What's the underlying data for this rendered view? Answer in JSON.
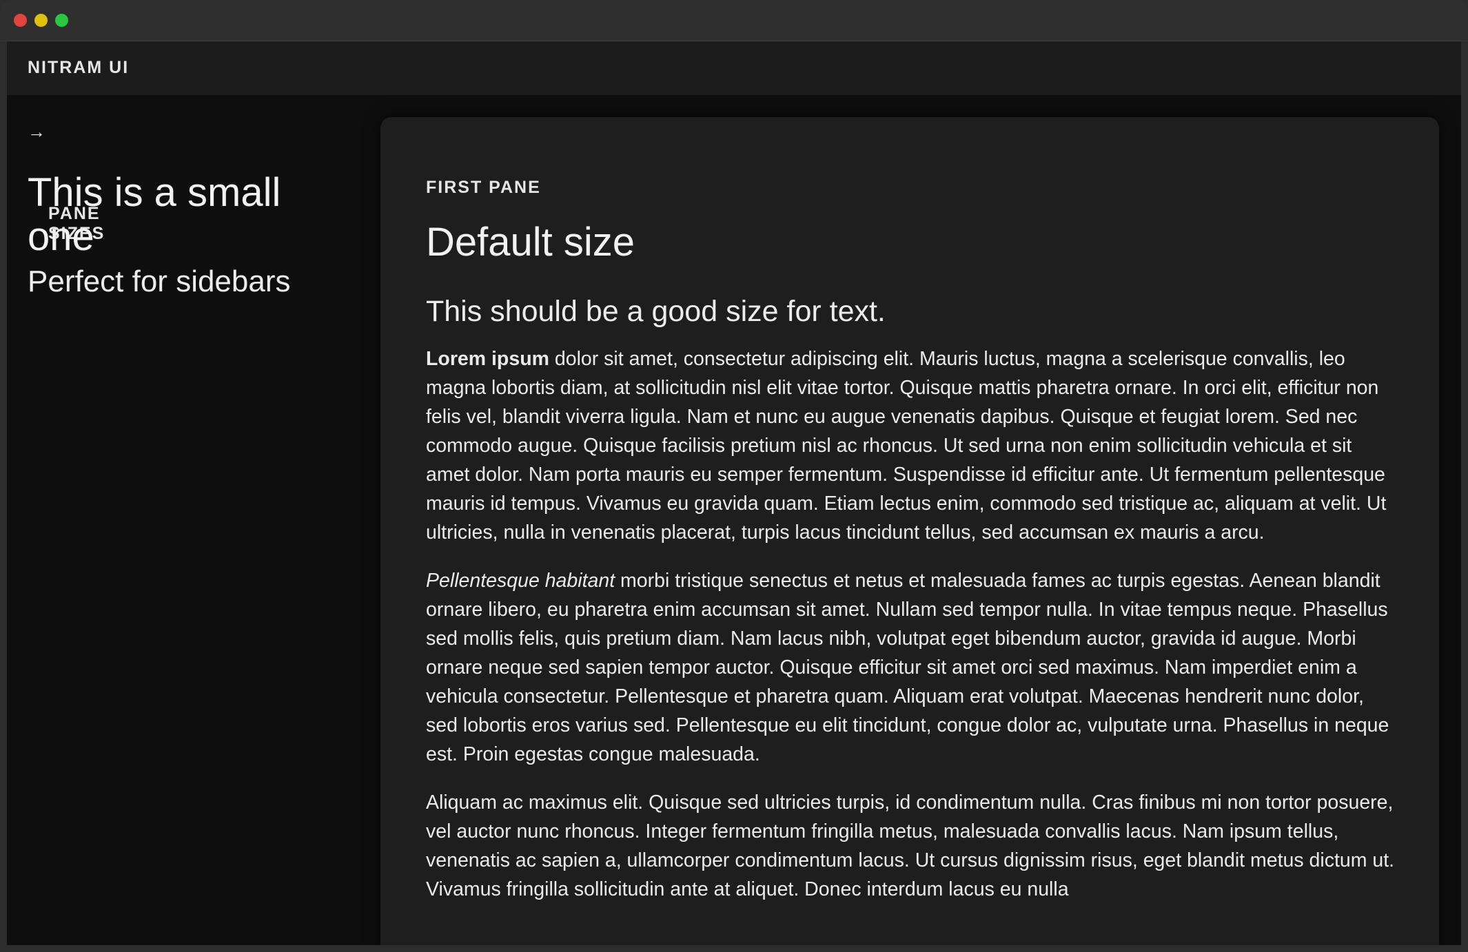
{
  "window": {
    "controls": [
      "close",
      "minimize",
      "maximize"
    ]
  },
  "app": {
    "title": "NITRAM UI"
  },
  "sidebar": {
    "eyebrow": "PANE SIZES",
    "arrow_icon": "→",
    "title": "This is a small one",
    "subtitle": "Perfect for sidebars"
  },
  "pane": {
    "eyebrow": "FIRST PANE",
    "title": "Default size",
    "subtitle": "This should be a good size for text.",
    "p1_lead": "Lorem ipsum",
    "p1_body": " dolor sit amet, consectetur adipiscing elit. Mauris luctus, magna a scelerisque convallis, leo magna lobortis diam, at sollicitudin nisl elit vitae tortor. Quisque mattis pharetra ornare. In orci elit, efficitur non felis vel, blandit viverra ligula. Nam et nunc eu augue venenatis dapibus. Quisque et feugiat lorem. Sed nec commodo augue. Quisque facilisis pretium nisl ac rhoncus. Ut sed urna non enim sollicitudin vehicula et sit amet dolor. Nam porta mauris eu semper fermentum. Suspendisse id efficitur ante. Ut fermentum pellentesque mauris id tempus. Vivamus eu gravida quam. Etiam lectus enim, commodo sed tristique ac, aliquam at velit. Ut ultricies, nulla in venenatis placerat, turpis lacus tincidunt tellus, sed accumsan ex mauris a arcu.",
    "p2_lead": "Pellentesque habitant",
    "p2_body": " morbi tristique senectus et netus et malesuada fames ac turpis egestas. Aenean blandit ornare libero, eu pharetra enim accumsan sit amet. Nullam sed tempor nulla. In vitae tempus neque. Phasellus sed mollis felis, quis pretium diam. Nam lacus nibh, volutpat eget bibendum auctor, gravida id augue. Morbi ornare neque sed sapien tempor auctor. Quisque efficitur sit amet orci sed maximus. Nam imperdiet enim a vehicula consectetur. Pellentesque et pharetra quam. Aliquam erat volutpat. Maecenas hendrerit nunc dolor, sed lobortis eros varius sed. Pellentesque eu elit tincidunt, congue dolor ac, vulputate urna. Phasellus in neque est. Proin egestas congue malesuada.",
    "p3": "Aliquam ac maximus elit. Quisque sed ultricies turpis, id condimentum nulla. Cras finibus mi non tortor posuere, vel auctor nunc rhoncus. Integer fermentum fringilla metus, malesuada convallis lacus. Nam ipsum tellus, venenatis ac sapien a, ullamcorper condimentum lacus. Ut cursus dignissim risus, eget blandit metus dictum ut. Vivamus fringilla sollicitudin ante at aliquet. Donec interdum lacus eu nulla"
  }
}
